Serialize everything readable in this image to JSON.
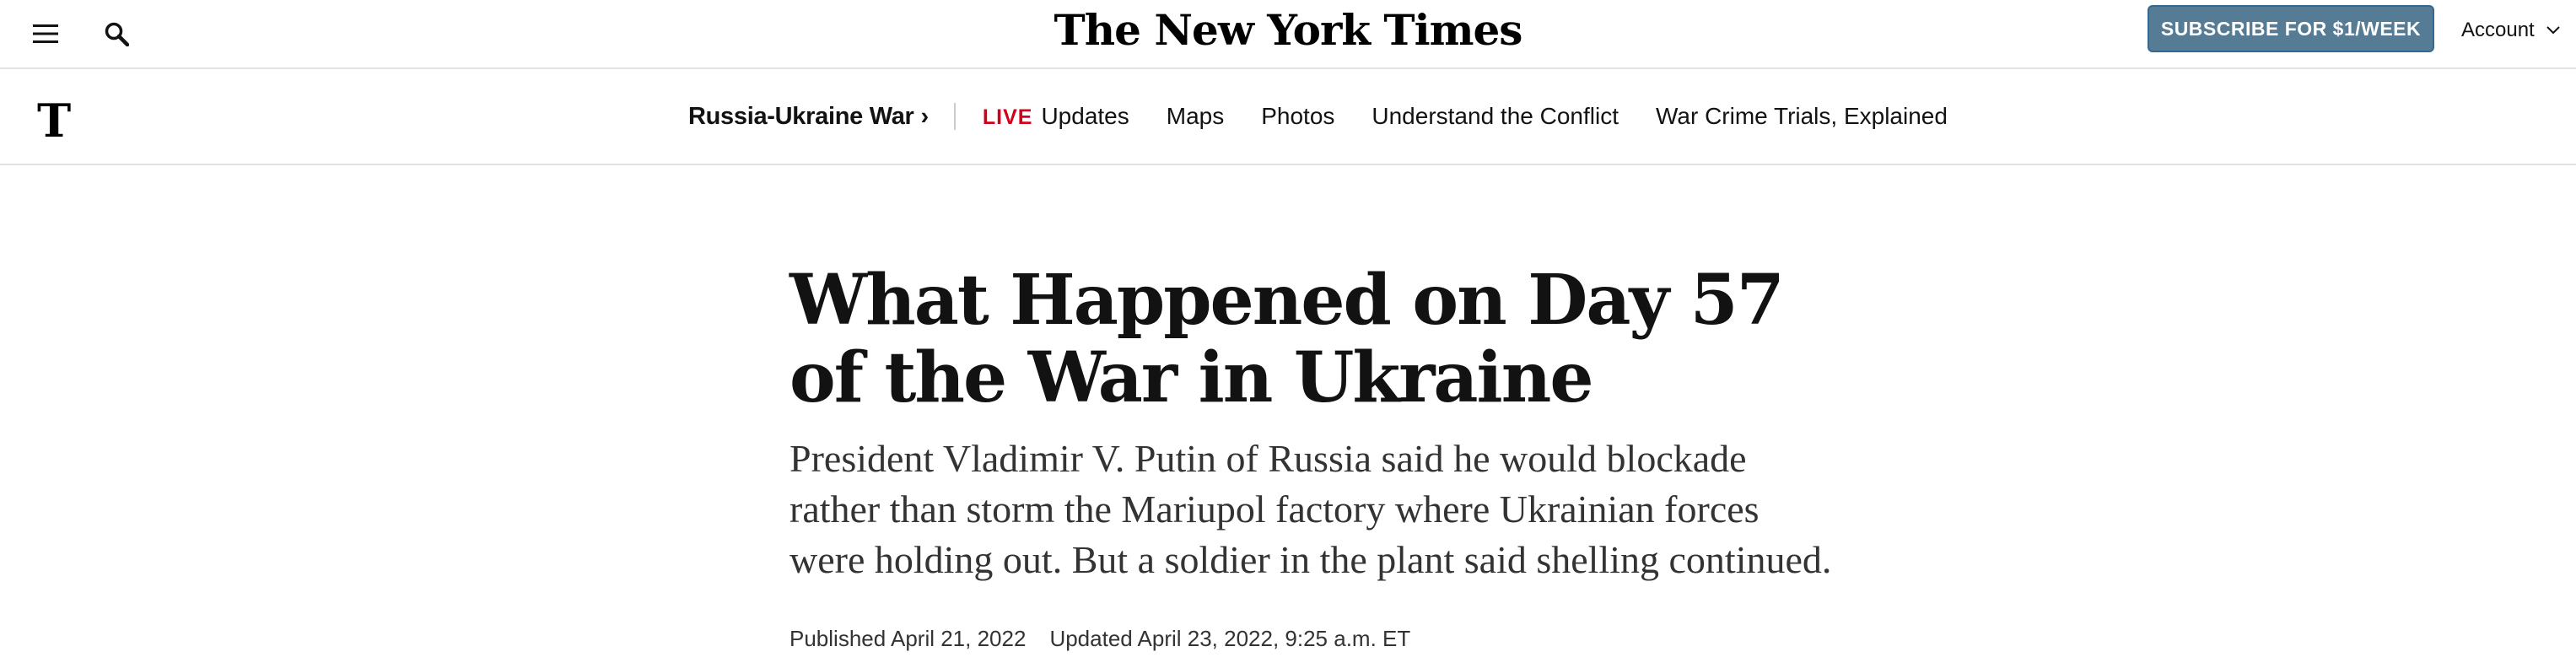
{
  "header": {
    "masthead": "The New York Times",
    "subscribe_label": "SUBSCRIBE FOR $1/WEEK",
    "account_label": "Account",
    "icons": [
      "menu-icon",
      "search-icon",
      "chevron-down-icon"
    ],
    "subscribe_color": "#567b95"
  },
  "nav": {
    "logo": "T",
    "section": "Russia-Ukraine War",
    "section_chevron": "›",
    "live_label": "LIVE",
    "links": [
      "Updates",
      "Maps",
      "Photos",
      "Understand the Conflict",
      "War Crime Trials, Explained"
    ],
    "live_color": "#d0021b"
  },
  "article": {
    "headline": "What Happened on Day 57 of the War in Ukraine",
    "summary": "President Vladimir V. Putin of Russia said he would blockade rather than storm the Mariupol factory where Ukrainian forces were holding out. But a soldier in the plant said shelling continued.",
    "published": "Published April 21, 2022",
    "updated": "Updated April 23, 2022, 9:25 a.m. ET"
  }
}
